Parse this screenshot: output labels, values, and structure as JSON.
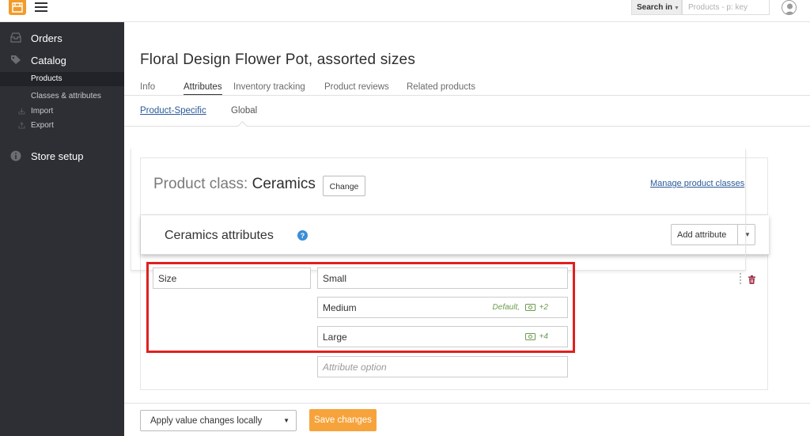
{
  "topbar": {
    "logo_icon": "store-logo-icon",
    "menu_icon": "hamburger-menu-icon",
    "search_scope_label": "Search in",
    "search_placeholder": "Products - p: key",
    "avatar_icon": "user-avatar-icon"
  },
  "sidebar": {
    "items": [
      {
        "label": "Orders",
        "icon": "inbox-icon"
      },
      {
        "label": "Catalog",
        "icon": "tag-icon"
      },
      {
        "label": "Store setup",
        "icon": "info-icon"
      }
    ],
    "sub_items": [
      {
        "label": "Products",
        "active": true
      },
      {
        "label": "Classes & attributes",
        "active": false
      },
      {
        "label": "Import",
        "icon": "import-icon",
        "active": false
      },
      {
        "label": "Export",
        "icon": "export-icon",
        "active": false
      }
    ]
  },
  "page": {
    "title": "Floral Design Flower Pot, assorted sizes",
    "tabs": [
      {
        "label": "Info",
        "active": false
      },
      {
        "label": "Attributes",
        "active": true
      },
      {
        "label": "Inventory tracking",
        "active": false
      },
      {
        "label": "Product reviews",
        "active": false
      },
      {
        "label": "Related products",
        "active": false
      }
    ],
    "subtabs": {
      "product_specific": "Product-Specific",
      "global": "Global"
    }
  },
  "product_class": {
    "label": "Product class:",
    "name": "Ceramics",
    "change_label": "Change",
    "manage_link": "Manage product classes"
  },
  "attributes": {
    "title": "Ceramics attributes",
    "add_label": "Add attribute",
    "name_value": "Size",
    "options": [
      {
        "value": "Small",
        "meta": "",
        "modifier": ""
      },
      {
        "value": "Medium",
        "meta": "Default,",
        "modifier": "+2"
      },
      {
        "value": "Large",
        "meta": "",
        "modifier": "+4"
      }
    ],
    "new_option_placeholder": "Attribute option"
  },
  "footer": {
    "apply_select_value": "Apply value changes locally",
    "save_label": "Save changes"
  },
  "colors": {
    "accent": "#f7a33b",
    "sidebar_bg": "#2e2f35",
    "link": "#2b5a9a",
    "highlight": "#e02020",
    "modifier": "#6b9b4e"
  }
}
